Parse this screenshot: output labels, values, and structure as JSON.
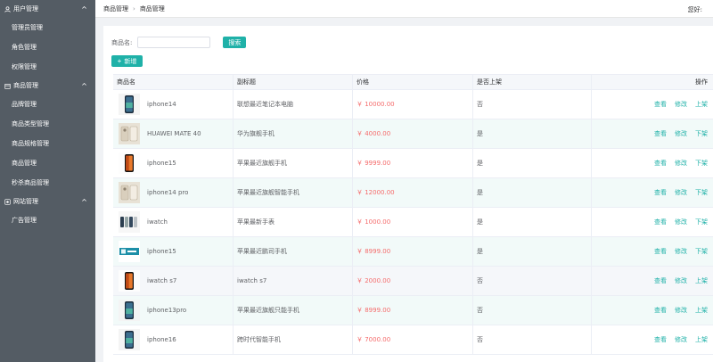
{
  "sidebar": {
    "groups": [
      {
        "label": "用户管理",
        "icon": "user-icon",
        "items": [
          "管理员管理",
          "角色管理",
          "权限管理"
        ]
      },
      {
        "label": "商品管理",
        "icon": "box-icon",
        "items": [
          "品牌管理",
          "商品类型管理",
          "商品规格管理",
          "商品管理",
          "秒杀商品管理"
        ]
      },
      {
        "label": "网站管理",
        "icon": "globe-icon",
        "items": [
          "广告管理"
        ]
      }
    ]
  },
  "header": {
    "breadcrumb": [
      "商品管理",
      "商品管理"
    ],
    "greeting": "您好:"
  },
  "search": {
    "label": "商品名:",
    "value": "",
    "placeholder": "",
    "button": "搜索"
  },
  "toolbar": {
    "add_label": "新增"
  },
  "table": {
    "columns": [
      "商品名",
      "副标题",
      "价格",
      "是否上架",
      "操作"
    ],
    "rows": [
      {
        "name": "iphone14",
        "subtitle": "联想最近笔记本电脑",
        "price": "￥ 10000.00",
        "on_shelf": "否",
        "actions": [
          "查看",
          "修改",
          "上架"
        ],
        "thumb": "phone-dark-icon"
      },
      {
        "name": "HUAWEI MATE 40",
        "subtitle": "华为旗舰手机",
        "price": "￥ 4000.00",
        "on_shelf": "是",
        "actions": [
          "查看",
          "修改",
          "下架"
        ],
        "thumb": "phone-pair-icon"
      },
      {
        "name": "iphone15",
        "subtitle": "苹果最近旗舰手机",
        "price": "￥ 9999.00",
        "on_shelf": "是",
        "actions": [
          "查看",
          "修改",
          "下架"
        ],
        "thumb": "phone-orange-icon"
      },
      {
        "name": "iphone14 pro",
        "subtitle": "苹果最近旗舰智能手机",
        "price": "￥ 12000.00",
        "on_shelf": "是",
        "actions": [
          "查看",
          "修改",
          "下架"
        ],
        "thumb": "phone-pair-icon"
      },
      {
        "name": "iwatch",
        "subtitle": "苹果最新手表",
        "price": "￥ 1000.00",
        "on_shelf": "是",
        "actions": [
          "查看",
          "修改",
          "下架"
        ],
        "thumb": "watch-icon"
      },
      {
        "name": "iphone15",
        "subtitle": "苹果最近鹏司手机",
        "price": "￥ 8999.00",
        "on_shelf": "是",
        "actions": [
          "查看",
          "修改",
          "下架"
        ],
        "thumb": "phone-banner-icon"
      },
      {
        "name": "iwatch s7",
        "subtitle": "iwatch s7",
        "price": "￥ 2000.00",
        "on_shelf": "否",
        "actions": [
          "查看",
          "修改",
          "上架"
        ],
        "thumb": "phone-orange-icon"
      },
      {
        "name": "iphone13pro",
        "subtitle": "苹果最近旗舰只能手机",
        "price": "￥ 8999.00",
        "on_shelf": "否",
        "actions": [
          "查看",
          "修改",
          "上架"
        ],
        "thumb": "phone-dark-icon"
      },
      {
        "name": "iphone16",
        "subtitle": "跨时代智能手机",
        "price": "￥ 7000.00",
        "on_shelf": "否",
        "actions": [
          "查看",
          "修改",
          "上架"
        ],
        "thumb": "phone-dark-icon"
      }
    ]
  },
  "colors": {
    "sidebar_bg": "#545c64",
    "accent": "#1fb1a8",
    "price": "#f56c6c"
  }
}
